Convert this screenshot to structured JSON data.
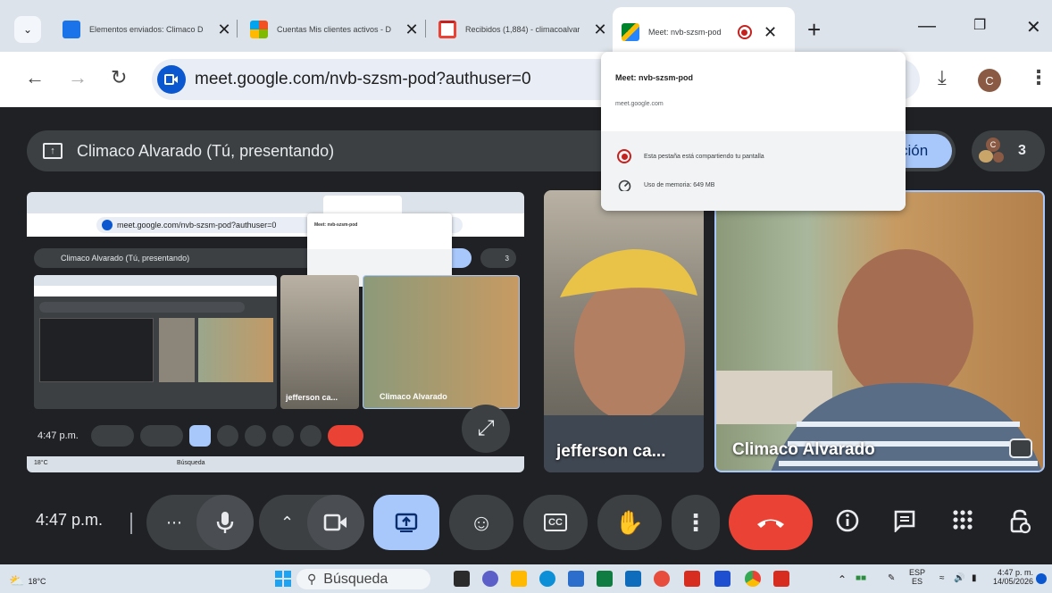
{
  "browser": {
    "tabs": [
      {
        "title": "Elementos enviados: Climaco Da",
        "color": "#1a73e8"
      },
      {
        "title": "Cuentas Mis clientes activos - Dy",
        "color": "#f25022"
      },
      {
        "title": "Recibidos (1,884) - climacoalvara",
        "color": "#ea4335"
      },
      {
        "title": "Meet: nvb-szsm-pod",
        "color": "#00832d"
      }
    ],
    "new_tab_label": "+",
    "address": "meet.google.com/nvb-szsm-pod?authuser=0",
    "profile_initial": "C"
  },
  "hovercard": {
    "title": "Meet: nvb-szsm-pod",
    "domain": "meet.google.com",
    "sharing_text": "Esta pestaña está compartiendo tu pantalla",
    "memory_text": "Uso de memoria: 649 MB"
  },
  "meet": {
    "banner_text": "Climaco Alvarado (Tú, presentando)",
    "stop_label": "ción",
    "participant_count": "3",
    "participants": [
      {
        "name": "jefferson ca..."
      },
      {
        "name": "Climaco Alvarado"
      }
    ],
    "time": "4:47 p.m.",
    "mini": {
      "address": "meet.google.com/nvb-szsm-pod?authuser=0",
      "banner_text": "Climaco Alvarado (Tú, presentando)",
      "stop_label": "ción",
      "participant_count": "3",
      "card_title": "Meet: nvb-szsm-pod",
      "name_jeff": "jefferson ca...",
      "name_climaco": "Climaco Alvarado",
      "time": "4:47 p.m.",
      "search": "Búsqueda",
      "temp": "18°C"
    }
  },
  "taskbar": {
    "weather": "18°C",
    "search_placeholder": "Búsqueda",
    "lang_top": "ESP",
    "lang_bottom": "ES",
    "time": "4:47 p. m.",
    "date": "14/05/2026"
  }
}
